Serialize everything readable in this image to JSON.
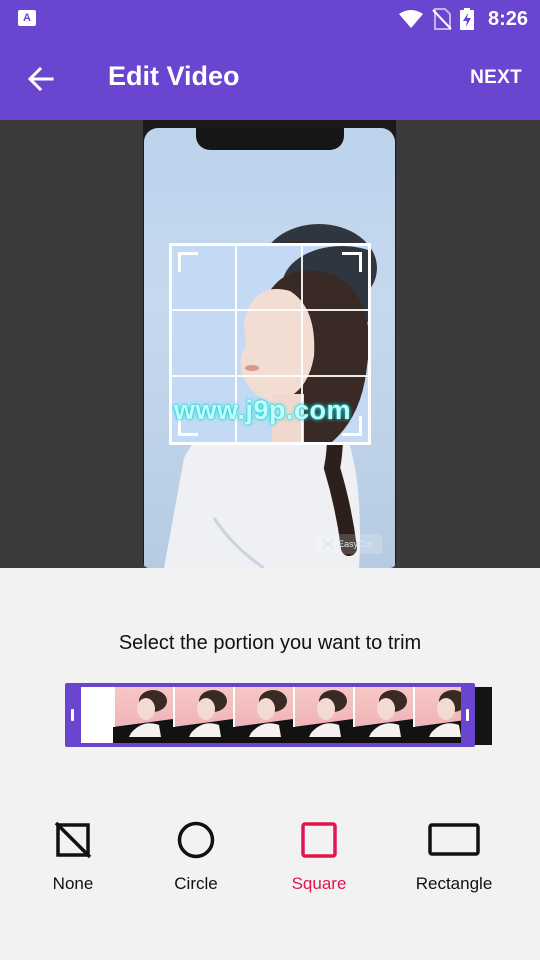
{
  "status_bar": {
    "time": "8:26",
    "icons": [
      "app-notification-icon",
      "wifi-icon",
      "no-sim-icon",
      "battery-charging-icon"
    ]
  },
  "app_bar": {
    "title": "Edit Video",
    "next_label": "NEXT",
    "back_icon": "arrow-left-icon"
  },
  "preview": {
    "watermark": "www.j9p.com",
    "app_badge": "EasyCut"
  },
  "trim": {
    "instruction": "Select the portion you want to trim",
    "thumbnail_count": 6
  },
  "shapes": [
    {
      "label": "None",
      "icon": "no-crop-icon",
      "active": false
    },
    {
      "label": "Circle",
      "icon": "circle-icon",
      "active": false
    },
    {
      "label": "Square",
      "icon": "square-icon",
      "active": true
    },
    {
      "label": "Rectangle",
      "icon": "rectangle-icon",
      "active": false
    }
  ],
  "colors": {
    "primary": "#6a45cf",
    "selected": "#e0174f",
    "background": "#f2f2f2"
  }
}
